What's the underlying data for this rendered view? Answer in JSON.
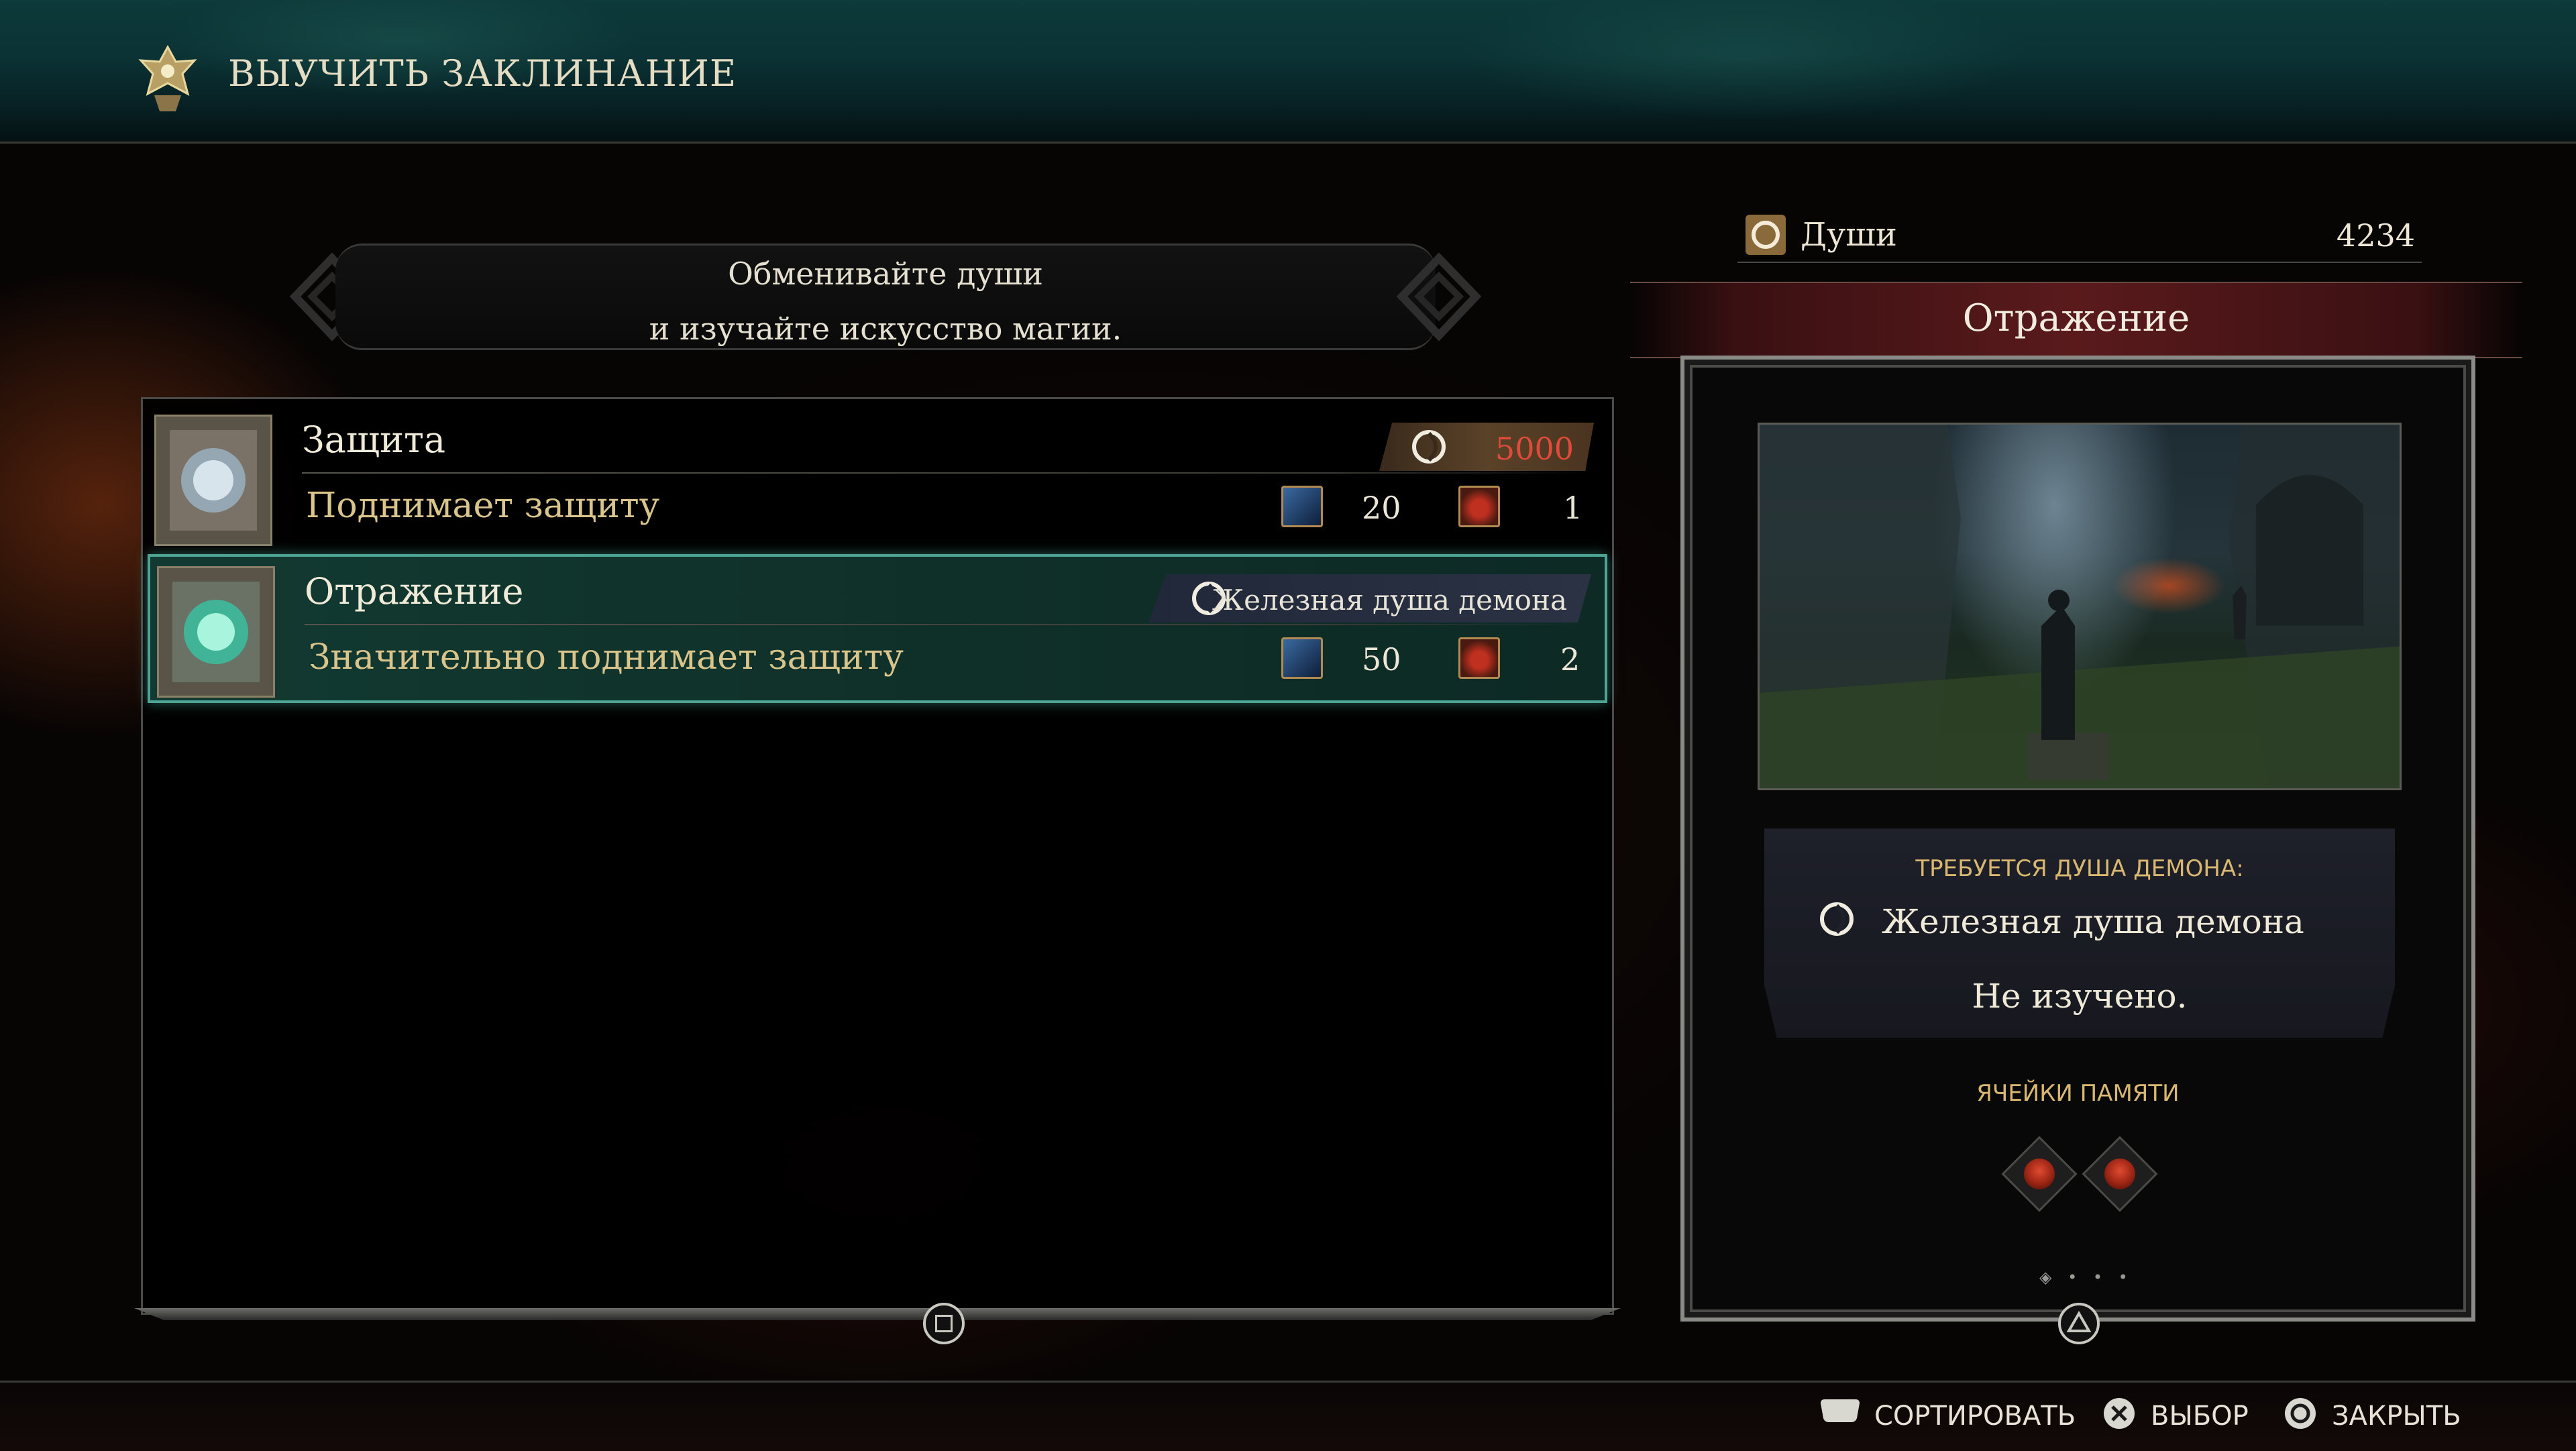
{
  "header": {
    "title": "ВЫУЧИТЬ ЗАКЛИНАНИЕ",
    "icon": "spell-helm-icon"
  },
  "banner": {
    "line1": "Обменивайте души",
    "line2": "и изучайте искусство магии."
  },
  "spells": [
    {
      "name": "Защита",
      "description": "Поднимает защиту",
      "cost_label": "5000",
      "intelligence": "20",
      "memory": "1",
      "selected": false
    },
    {
      "name": "Отражение",
      "description": "Значительно поднимает защиту",
      "requirement": "Железная душа демона",
      "intelligence": "50",
      "memory": "2",
      "selected": true
    }
  ],
  "details": {
    "souls_label": "Души",
    "souls_value": "4234",
    "title": "Отражение",
    "req_heading": "ТРЕБУЕТСЯ ДУША ДЕМОНА:",
    "req_soul": "Железная душа демона",
    "req_status": "Не изучено.",
    "memory_heading": "ЯЧЕЙКИ ПАМЯТИ",
    "memory_slots": 2
  },
  "footer": {
    "sort_label": "СОРТИРОВАТЬ",
    "select_label": "ВЫБОР",
    "close_label": "ЗАКРЫТЬ"
  },
  "colors": {
    "accent_teal": "#4ea494",
    "cost_red": "#e04a3a",
    "gold_text": "#d9c48c"
  }
}
